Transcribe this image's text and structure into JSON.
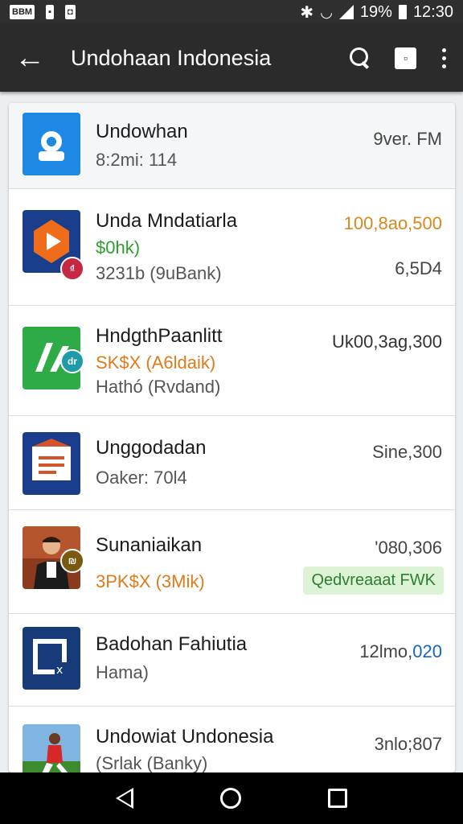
{
  "status_bar": {
    "left_icons": [
      "BBM",
      "msg",
      "app"
    ],
    "left_labels": [
      "BBM",
      "▪",
      "◘"
    ],
    "bluetooth": "✱",
    "battery_text": "19%",
    "time": "12:30"
  },
  "app_bar": {
    "title": "Undohaan Indonesia",
    "back_icon": "←",
    "filter_icon_text": "▫"
  },
  "rows": [
    {
      "title": "Undowhan",
      "sub1": "8:2mi: 114",
      "right1": "9ver. FM",
      "thumb_color": "#1e88e5"
    },
    {
      "title": "Unda Mndatiarla",
      "sub1": "$0hk)",
      "sub2": "3231b (9uBank)",
      "right1": "100,8ao,500",
      "right2": "6,5D4",
      "badge": "₫"
    },
    {
      "title": "HndgthPaanlitt",
      "sub1": "SK$X (A6ldaik)",
      "sub2": "Hathó (Rvdand)",
      "right1": "Uk00,3ag,300",
      "badge": "dr"
    },
    {
      "title": "Unggodadan",
      "sub1": "Oaker: 70l4",
      "right1": "Sine,300"
    },
    {
      "title": "Sunaniaikan",
      "sub1": "3PK$X (3Mik)",
      "right1": "'080,306",
      "chip": "Qedvreaaat FWK",
      "badge": "₪"
    },
    {
      "title": "Badohan Fahiutia",
      "sub1": "Hama)",
      "right1": "12lmo,",
      "right1_accent": "020"
    },
    {
      "title": "Undowiat Undonesia",
      "sub1": "(Srlak (Banky)",
      "right1": "3nlo;807"
    }
  ],
  "colors": {
    "app_bar": "#2b2b2b",
    "accent_green": "#2e9e2e",
    "accent_orange": "#e07b1a",
    "chip_bg": "#dcf3d6",
    "accent_blue": "#1565c0"
  }
}
